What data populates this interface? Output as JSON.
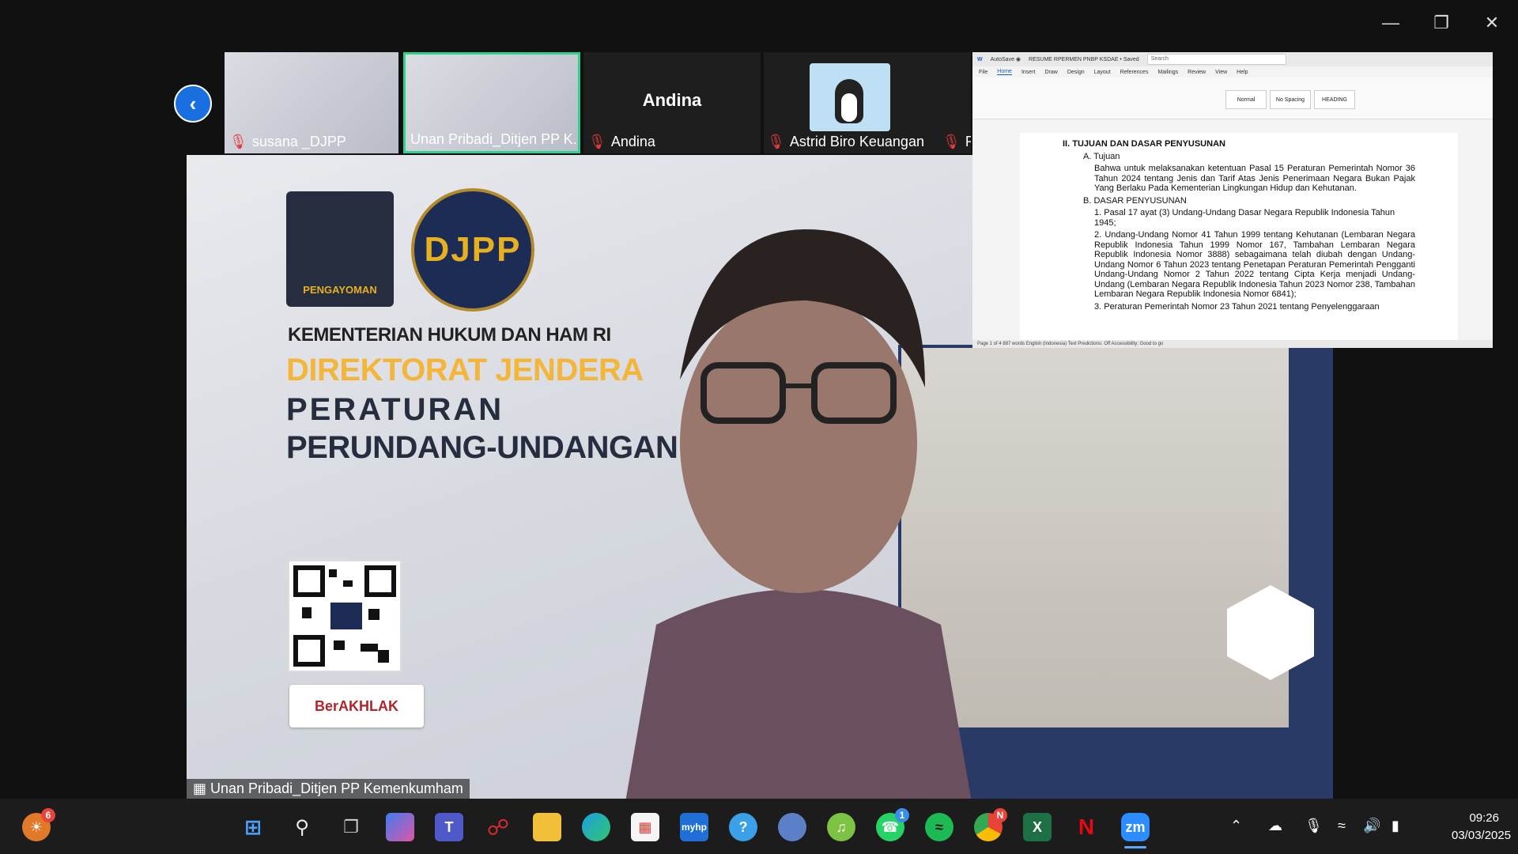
{
  "participants": [
    {
      "name": "susana _DJPP",
      "muted": true
    },
    {
      "name": "Unan Pribadi_Ditjen PP K...",
      "muted": false
    },
    {
      "name": "Andina",
      "muted": true
    },
    {
      "name": "Astrid Biro Keuangan",
      "muted": true
    },
    {
      "name": "R",
      "muted": true
    }
  ],
  "big_name": "Andina",
  "slide": {
    "logo_text": "PENGAYOMAN",
    "djpp": "DJPP",
    "ministry": "KEMENTERIAN HUKUM DAN HAM RI",
    "directorate": "DIREKTORAT JENDERA",
    "peraturan": "PERATURAN",
    "perundangan": "PERUNDANG-UNDANGAN",
    "berakhlak": "BerAKHLAK"
  },
  "active_speaker": "Unan Pribadi_Ditjen PP Kemenkumham",
  "word": {
    "title": "RESUME RPERMEN PNBP KSDAE • Saved",
    "search_placeholder": "Search",
    "menu": [
      "File",
      "Home",
      "Insert",
      "Draw",
      "Design",
      "Layout",
      "References",
      "Mailings",
      "Review",
      "View",
      "Help"
    ],
    "active_menu": "Home",
    "styles": [
      "Normal",
      "No Spacing",
      "HEADING"
    ],
    "section_heading": "II.    TUJUAN DAN DASAR PENYUSUNAN",
    "a_label": "A.   Tujuan",
    "a_text": "Bahwa untuk melaksanakan ketentuan Pasal 15 Peraturan Pemerintah Nomor 36 Tahun 2024 tentang Jenis dan Tarif Atas Jenis Penerimaan Negara Bukan Pajak Yang Berlaku Pada Kementerian Lingkungan Hidup dan Kehutanan.",
    "b_label": "B.   DASAR PENYUSUNAN",
    "item1": "1.   Pasal 17 ayat (3) Undang-Undang Dasar Negara Republik Indonesia Tahun 1945;",
    "item2": "2.   Undang-Undang Nomor 41 Tahun 1999 tentang Kehutanan (Lembaran Negara Republik Indonesia Tahun 1999 Nomor 167, Tambahan Lembaran Negara Republik Indonesia Nomor 3888) sebagaimana telah diubah dengan Undang-Undang Nomor 6 Tahun 2023 tentang Penetapan Peraturan Pemerintah Pengganti Undang-Undang Nomor 2 Tahun 2022 tentang Cipta Kerja menjadi Undang-Undang (Lembaran Negara Republik Indonesia Tahun 2023 Nomor 238, Tambahan Lembaran Negara Republik Indonesia Nomor 6841);",
    "item3": "3.   Peraturan Pemerintah Nomor 23 Tahun 2021 tentang Penyelenggaraan",
    "status": "Page 1 of 4   887 words   English (Indonesia)   Text Predictions: Off   Accessibility: Good to go"
  },
  "taskbar": {
    "icons": [
      "weather-icon",
      "windows-start-icon",
      "search-icon",
      "task-view-icon",
      "copilot-icon",
      "teams-icon",
      "mcafee-icon",
      "file-explorer-icon",
      "edge-icon",
      "store-icon",
      "myhp-icon",
      "help-icon",
      "zoom-outlook-icon",
      "itunes-icon",
      "whatsapp-icon",
      "spotify-icon",
      "chrome-icon",
      "excel-icon",
      "netflix-icon",
      "zoom-icon"
    ],
    "weather_badge": "6",
    "whatsapp_badge": "1",
    "chrome_badge": "N",
    "zoom_label": "zm",
    "time": "09:26",
    "date": "03/03/2025"
  }
}
